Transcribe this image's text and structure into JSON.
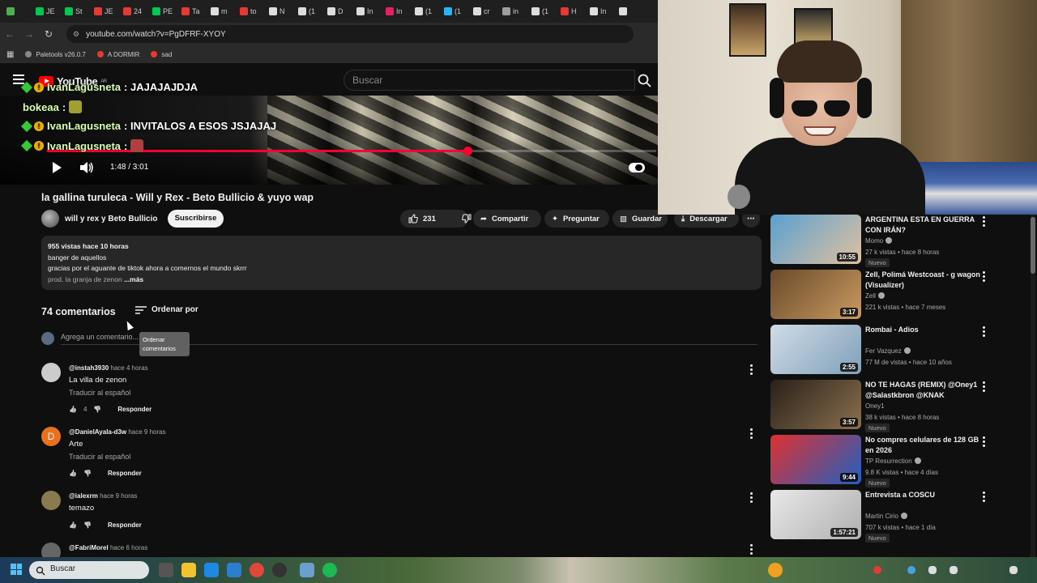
{
  "browser": {
    "tabs": [
      {
        "label": "",
        "color": "#4caf50"
      },
      {
        "label": "JE",
        "color": "#00c853"
      },
      {
        "label": "St",
        "color": "#00c853"
      },
      {
        "label": "JE",
        "color": "#e53935"
      },
      {
        "label": "24",
        "color": "#e53935"
      },
      {
        "label": "PE",
        "color": "#00c853"
      },
      {
        "label": "Ta",
        "color": "#e53935"
      },
      {
        "label": "m",
        "color": "#dddddd"
      },
      {
        "label": "to",
        "color": "#e53935"
      },
      {
        "label": "N",
        "color": "#dddddd"
      },
      {
        "label": "(1",
        "color": "#dddddd"
      },
      {
        "label": "D",
        "color": "#dddddd"
      },
      {
        "label": "In",
        "color": "#dddddd"
      },
      {
        "label": "In",
        "color": "#e91e63"
      },
      {
        "label": "(1",
        "color": "#dddddd"
      },
      {
        "label": "(1",
        "color": "#29b6f6"
      },
      {
        "label": "cr",
        "color": "#dddddd"
      },
      {
        "label": "in",
        "color": "#9e9e9e"
      },
      {
        "label": "(1",
        "color": "#dddddd"
      },
      {
        "label": "H",
        "color": "#e53935"
      },
      {
        "label": "In",
        "color": "#dddddd"
      },
      {
        "label": "",
        "color": "#dddddd"
      }
    ],
    "url": "youtube.com/watch?v=PgDFRF-XYOY",
    "bookmarks": [
      {
        "label": "Paletools v26.0.7",
        "color": "#888888"
      },
      {
        "label": "A DORMIR",
        "color": "#e53935"
      },
      {
        "label": "sad",
        "color": "#e53935"
      }
    ]
  },
  "header": {
    "logo": "YouTube",
    "country": "AR",
    "search_placeholder": "Buscar"
  },
  "chat": [
    {
      "name": "IvanLagusneta",
      "text": ": JAJAJAJDJA",
      "badges": true,
      "emote": false
    },
    {
      "name": "bokeaa",
      "text": " :",
      "badges": false,
      "emote": true,
      "emote_color": "#a0a030"
    },
    {
      "name": "IvanLagusneta",
      "text": ": INVITALOS A ESOS JSJAJAJ",
      "badges": true,
      "emote": false
    },
    {
      "name": "IvanLagusneta",
      "text": " :",
      "badges": true,
      "emote": true,
      "emote_color": "#b04040"
    }
  ],
  "player": {
    "current_time": "1:48 / 3:01",
    "progress": 0.69
  },
  "video": {
    "title": "la gallina turuleca - Will y Rex - Beto Bullicio & yuyo wap",
    "channel": "will y rex y Beto Bullicio",
    "subscribe": "Suscribirse",
    "likes": "231",
    "share": "Compartir",
    "ask": "Preguntar",
    "save": "Guardar",
    "download": "Descargar"
  },
  "description": {
    "stats": "955 vistas  hace 10 horas",
    "lines": [
      "banger de aquellos",
      "gracias por el aguante de tiktok ahora a comernos el mundo skrrr",
      "prod. la granja de zenon"
    ],
    "more": "...más"
  },
  "comments": {
    "count": "74 comentarios",
    "sort_label": "Ordenar por",
    "tooltip": "Ordenar comentarios",
    "add_placeholder": "Agrega un comentario...",
    "reply_label": "Responder",
    "translate_label": "Traducir al español",
    "items": [
      {
        "author": "@instah3930",
        "ago": "hace 4 horas",
        "text": "La villa de zenon",
        "translate": true,
        "likes": "4",
        "avatar_color": "#ccc"
      },
      {
        "author": "@DanielAyala-d3w",
        "ago": "hace 9 horas",
        "text": "Arte",
        "translate": true,
        "likes": "",
        "avatar_color": "#e8711c",
        "initial": "D"
      },
      {
        "author": "@ialexrm",
        "ago": "hace 9 horas",
        "text": "temazo",
        "translate": false,
        "likes": "",
        "avatar_color": "#8a7a50"
      },
      {
        "author": "@FabriMorel",
        "ago": "hace 6 horas",
        "text": "",
        "translate": false,
        "likes": "",
        "avatar_color": "#666"
      }
    ]
  },
  "sidebar": [
    {
      "title": "ARGENTINA ESTA EN GUERRA CON IRÁN?",
      "channel": "Momo",
      "verified": true,
      "meta": "27 k vistas • hace 8 horas",
      "new": "Nuevo",
      "duration": "10:55",
      "c1": "#5aa0d0",
      "c2": "#e0c0a0"
    },
    {
      "title": "Zell, Polimá Westcoast - g wagon (Visualizer)",
      "channel": "Zell",
      "verified": true,
      "meta": "221 k vistas • hace 7 meses",
      "new": "",
      "duration": "3:17",
      "c1": "#6a4a2a",
      "c2": "#c89a60"
    },
    {
      "title": "Rombai - Adios",
      "channel": "Fer Vazquez",
      "verified": true,
      "meta": "77 M de vistas • hace 10 años",
      "new": "",
      "duration": "2:55",
      "c1": "#d0dce8",
      "c2": "#80a0b8"
    },
    {
      "title": "NO TE HAGAS (REMIX) @Oney1 @Salastkbron @KNAK",
      "channel": "Oney1",
      "verified": false,
      "meta": "38 k vistas • hace 8 horas",
      "new": "Nuevo",
      "duration": "3:57",
      "c1": "#2a2018",
      "c2": "#8a7050"
    },
    {
      "title": "No compres celulares de 128 GB en 2026",
      "channel": "TP Resurrection",
      "verified": true,
      "meta": "9.8 K vistas • hace 4 días",
      "new": "Nuevo",
      "duration": "9:44",
      "c1": "#e03030",
      "c2": "#2060c0"
    },
    {
      "title": "Entrevista a COSCU",
      "channel": "Martin Cirio",
      "verified": true,
      "meta": "707 k vistas • hace 1 día",
      "new": "Nuevo",
      "duration": "1:57:21",
      "c1": "#e8e8e8",
      "c2": "#b0b0b0"
    }
  ],
  "taskbar": {
    "search_placeholder": "Buscar"
  }
}
